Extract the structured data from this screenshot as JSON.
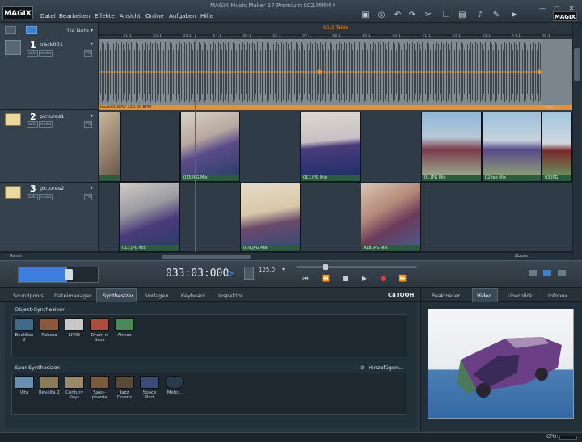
{
  "app": {
    "logo": "MAGIX",
    "title": "MAGIX Music Maker 17 Premium          002.MMM *",
    "right_logo": "MAGIX"
  },
  "menu": [
    "Datei",
    "Bearbeiten",
    "Effekte",
    "Ansicht",
    "Online",
    "Aufgaben",
    "Hilfe"
  ],
  "toolbar_icons": [
    "save-icon",
    "globe-icon",
    "undo-icon",
    "redo-icon",
    "scissors-icon",
    "copy-icon",
    "paste-icon",
    "note-icon",
    "pencil-icon",
    "pointer-icon"
  ],
  "ruler": {
    "quantize": "1/4 Note",
    "marker": "66:3 Takte",
    "ticks": [
      "31:1",
      "32:1",
      "33:1",
      "34:1",
      "35:1",
      "36:1",
      "37:1",
      "38:1",
      "39:1",
      "40:1",
      "41:1",
      "42:1",
      "43:1",
      "44:1",
      "45:1"
    ]
  },
  "tracks": [
    {
      "number": "1",
      "name": "track001",
      "solo": "solo",
      "mute": "mute",
      "fx": "FX"
    },
    {
      "number": "2",
      "name": "pictures1",
      "solo": "solo",
      "mute": "mute",
      "fx": "FX"
    },
    {
      "number": "3",
      "name": "pictures2",
      "solo": "solo",
      "mute": "mute",
      "fx": "FX"
    }
  ],
  "audio_clip": {
    "label": "track01.WAV  120.00 BPM",
    "end_label": "tra..."
  },
  "clips_row2": [
    "015.JPG Mix",
    "017.JPG Mix",
    "01.JPG Mix",
    "02.jpg Mix",
    "03.JPG"
  ],
  "clips_row3": [
    "013.JPG Mix",
    "016.JPG Mix",
    "018.JPG Mix"
  ],
  "bottom_left_label": "Reset",
  "zoom_label": "Zoom",
  "transport": {
    "timecode": "033:03:000",
    "tempo": "125.0",
    "bpm_label": "BPM"
  },
  "lower_tabs": [
    "Soundpools",
    "Dateimanager",
    "Synthesizer",
    "Vorlagen",
    "Keyboard",
    "Inspektor"
  ],
  "active_lower_tab": "Synthesizer",
  "catooh": "CaTOOH",
  "object_synth": {
    "label": "Objekt-Synthesizer:",
    "items": [
      {
        "name": "BeatBox 2",
        "color": "#3d6b8a"
      },
      {
        "name": "Robota",
        "color": "#8a5a3d"
      },
      {
        "name": "LIVID",
        "color": "#c8c8c8"
      },
      {
        "name": "Drum n Bass",
        "color": "#b04a3d"
      },
      {
        "name": "Atmos",
        "color": "#4a8a5a"
      }
    ]
  },
  "track_synth": {
    "label": "Spur-Synthesizer:",
    "add_label": "Hinzufügen...",
    "items": [
      {
        "name": "Vita",
        "color": "#6a8fb0"
      },
      {
        "name": "Revolta 2",
        "color": "#8a7a5a"
      },
      {
        "name": "Century Keys",
        "color": "#9a8a6a"
      },
      {
        "name": "Saxo-phonia",
        "color": "#7a5a3a"
      },
      {
        "name": "Jazz Drums",
        "color": "#5a4a3a"
      },
      {
        "name": "Space Pad",
        "color": "#3a4a7a"
      },
      {
        "name": "Mehr...",
        "color": "#2a3a4a"
      }
    ]
  },
  "right_tabs": [
    "Peakmeter",
    "Video",
    "Überblick",
    "Infobox"
  ],
  "active_right_tab": "Video",
  "status": {
    "cpu": "CPU:"
  }
}
